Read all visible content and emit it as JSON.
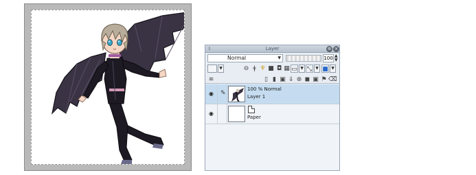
{
  "layer_panel": {
    "title": "Layer",
    "blend_mode": "Normal",
    "opacity_value": "100",
    "layers": [
      {
        "opacity_mode": "100 % Normal",
        "name": "Layer 1",
        "selected": true
      },
      {
        "name": "Paper",
        "selected": false
      }
    ]
  },
  "icons": {
    "eye": "eye-icon",
    "pen": "pen-icon",
    "close": "close-icon",
    "menu": "menu-icon"
  },
  "colors": {
    "selected_row": "#c5dcf0",
    "panel_bg": "#e8edf3",
    "canvas_gray": "#b9b9b9"
  }
}
